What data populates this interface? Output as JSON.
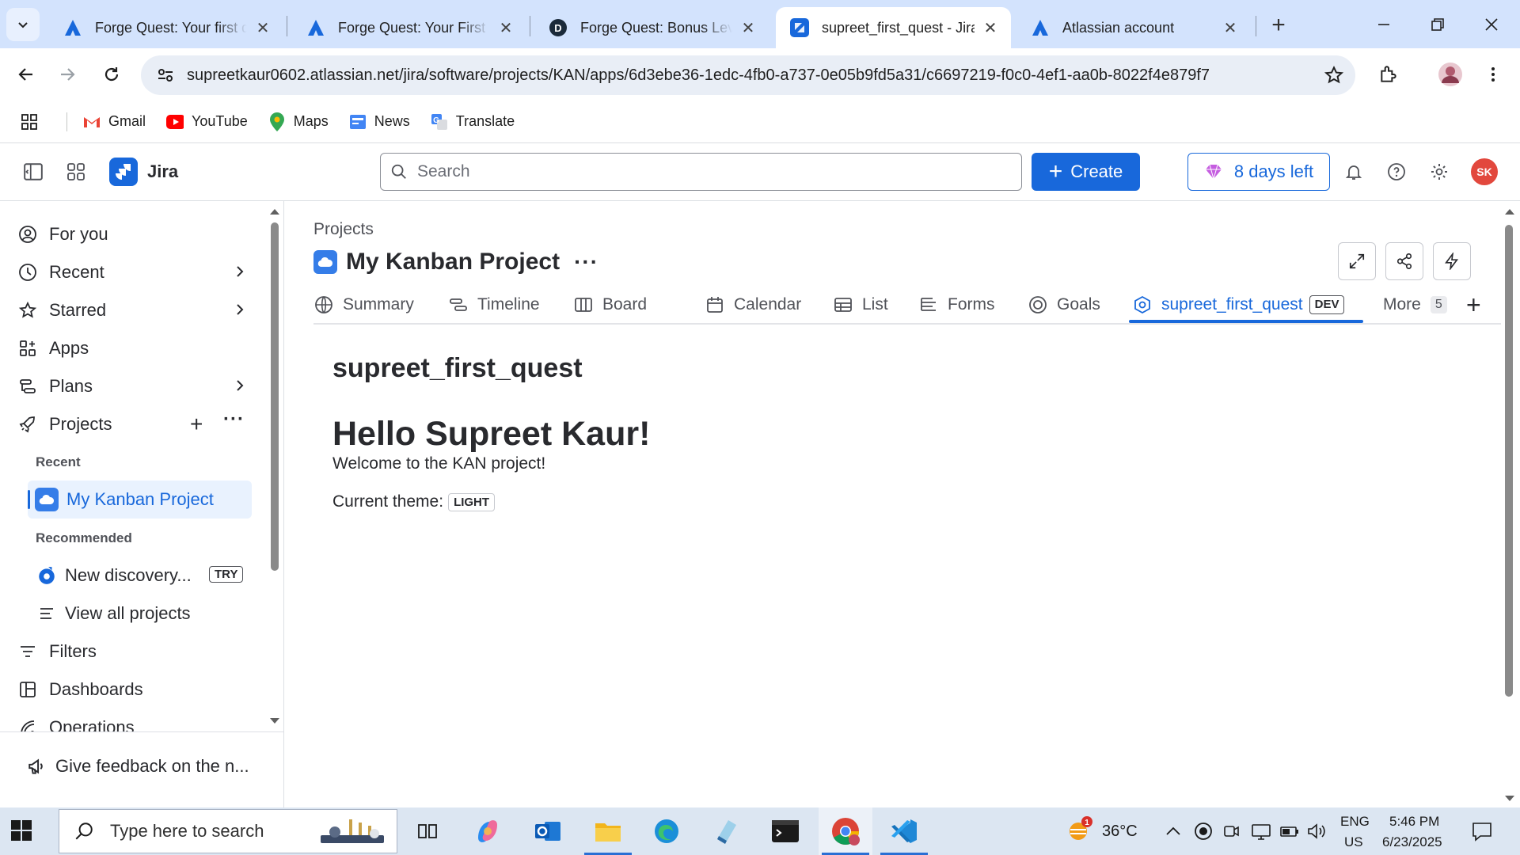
{
  "browser": {
    "tabs": [
      {
        "title": "Forge Quest: Your first qu",
        "favicon": "atlassian-icon"
      },
      {
        "title": "Forge Quest: Your First Q",
        "favicon": "atlassian-icon"
      },
      {
        "title": "Forge Quest: Bonus Level",
        "favicon": "dev-icon"
      },
      {
        "title": "supreet_first_quest - Jira",
        "favicon": "jira-icon",
        "active": true
      },
      {
        "title": "Atlassian account",
        "favicon": "atlassian-icon"
      }
    ],
    "url": "supreetkaur0602.atlassian.net/jira/software/projects/KAN/apps/6d3ebe36-1edc-4fb0-a737-0e05b9fd5a31/c6697219-f0c0-4ef1-aa0b-8022f4e879f7",
    "bookmarks": [
      "Gmail",
      "YouTube",
      "Maps",
      "News",
      "Translate"
    ]
  },
  "jira": {
    "product": "Jira",
    "search_placeholder": "Search",
    "create_label": "Create",
    "trial_label": "8 days left",
    "avatar_initials": "SK"
  },
  "sidebar": {
    "items": [
      {
        "label": "For you"
      },
      {
        "label": "Recent"
      },
      {
        "label": "Starred"
      },
      {
        "label": "Apps"
      },
      {
        "label": "Plans"
      },
      {
        "label": "Projects"
      }
    ],
    "recent_heading": "Recent",
    "recent_project": "My Kanban Project",
    "recommended_heading": "Recommended",
    "recommended_item": "New discovery...",
    "try_badge": "TRY",
    "view_all": "View all projects",
    "lower_items": [
      {
        "label": "Filters"
      },
      {
        "label": "Dashboards"
      },
      {
        "label": "Operations"
      }
    ],
    "feedback": "Give feedback on the n..."
  },
  "main": {
    "breadcrumb": "Projects",
    "project_title": "My Kanban Project",
    "tabs": [
      {
        "label": "Summary"
      },
      {
        "label": "Timeline"
      },
      {
        "label": "Board"
      },
      {
        "label": "Calendar"
      },
      {
        "label": "List"
      },
      {
        "label": "Forms"
      },
      {
        "label": "Goals"
      },
      {
        "label": "supreet_first_quest",
        "badge": "DEV",
        "active": true
      },
      {
        "label": "More",
        "count": "5"
      }
    ],
    "content": {
      "title": "supreet_first_quest",
      "hello": "Hello Supreet Kaur!",
      "welcome": "Welcome to the KAN project!",
      "theme_label": "Current theme:",
      "theme_value": "LIGHT"
    }
  },
  "taskbar": {
    "search_placeholder": "Type here to search",
    "weather_temp": "36°C",
    "weather_badge": "1",
    "lang_top": "ENG",
    "lang_bottom": "US",
    "time": "5:46 PM",
    "date": "6/23/2025"
  },
  "colors": {
    "brand": "#1868db",
    "chrome_tabstrip": "#d3e3fd",
    "avatar": "#e2483d",
    "sidebar_active": "#e9f2fe"
  }
}
